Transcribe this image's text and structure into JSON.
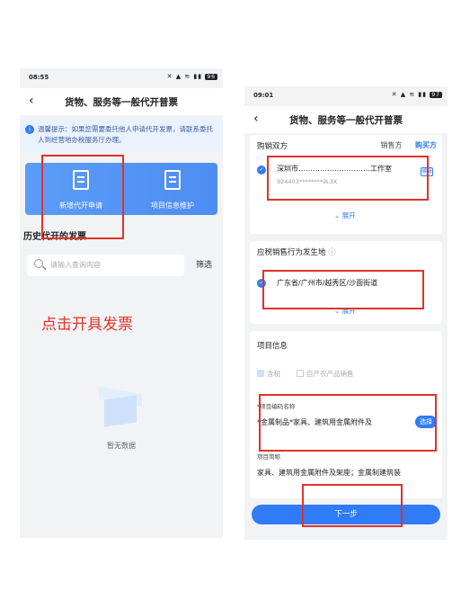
{
  "left": {
    "status": {
      "time": "08:55",
      "icons": "✕ ▲ ≋ ▮▮",
      "battery": "96"
    },
    "title": "货物、服务等一般代开普票",
    "tip": "温馨提示：如果您需要委托他人申请代开发票，请联系委托人到经营地办税服务厅办理。",
    "actions": [
      {
        "label": "新增代开申请"
      },
      {
        "label": "项目信息维护"
      }
    ],
    "history_title": "历史代开的发票",
    "search_placeholder": "请输入查询内容",
    "filter_label": "筛选",
    "annotation": "点击开具发票",
    "empty_text": "暂无数据"
  },
  "right": {
    "status": {
      "time": "09:01",
      "icons": "✕ ▲ ≋ ▮▮",
      "battery": "97"
    },
    "title": "货物、服务等一般代开普票",
    "parties": {
      "title": "购销双方",
      "tabs": [
        "销售方",
        "购买方"
      ],
      "name": "深圳市…………………………工作室",
      "id": "924403********9L3X",
      "edit": "编辑",
      "expand": "展开"
    },
    "location": {
      "title": "应税销售行为发生地",
      "info_icon": "ⓘ",
      "value": "广东省/广州市/越秀区/沙面街道",
      "expand": "展开"
    },
    "project": {
      "title": "项目信息",
      "opt_tax": "含税",
      "opt_farm": "自产农产品销售",
      "code_label": "*项目编码名称",
      "code_value": "*金属制品*家具、建筑用金属附件及",
      "select": "选择",
      "short_label": "项目简称",
      "short_value": "家具、建筑用金属附件及架座；金属制建筑装"
    },
    "next": "下一步"
  },
  "colors": {
    "accent": "#2f7cf6",
    "annotation_red": "#e0322a"
  }
}
